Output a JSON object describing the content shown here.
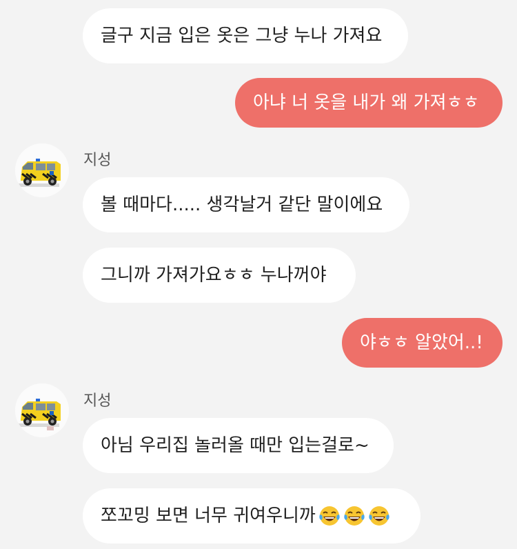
{
  "messages": [
    {
      "text": "글구 지금 입은 옷은 그냥 누나 가져요"
    },
    {
      "text": "아냐 너 옷을 내가 왜 가져ㅎㅎ"
    },
    {
      "text": "볼 때마다..... 생각날거 같단 말이에요"
    },
    {
      "text": "그니까 가져가요ㅎㅎ 누나꺼야"
    },
    {
      "text": "야ㅎㅎ 알았어..!"
    },
    {
      "text": "아님 우리집 놀러올 때만 입는걸로~"
    },
    {
      "text": "쪼꼬밍 보면 너무 귀여우니까"
    }
  ],
  "sender_name": "지성",
  "avatar_icon": "ambulance-icon",
  "emoji_icon": "laughing-tears-emoji",
  "colors": {
    "sent_bubble": "#ee7069",
    "received_bubble": "#ffffff",
    "background": "#f3f3f3"
  }
}
